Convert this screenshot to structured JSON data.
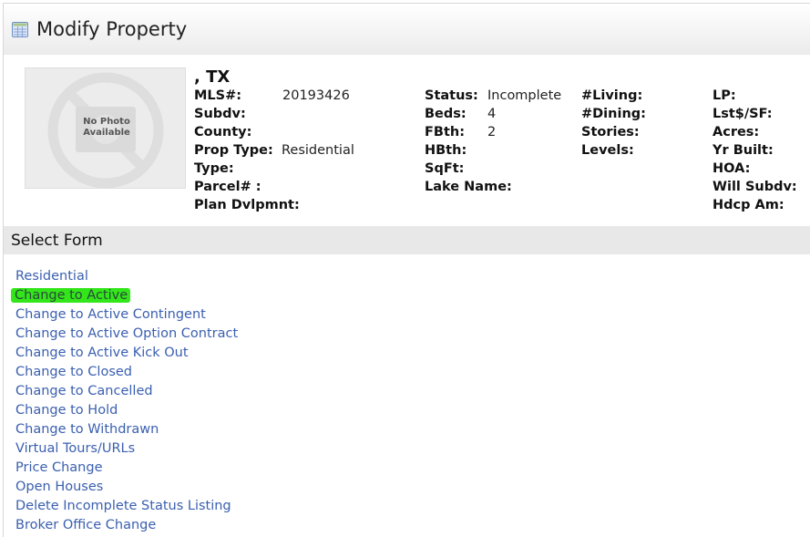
{
  "header": {
    "title": "Modify Property",
    "icon": "table-form-icon"
  },
  "listing": {
    "photo_placeholder": [
      "No Photo",
      "Available"
    ],
    "address": ", TX",
    "column1": [
      {
        "label": "MLS#:",
        "value": "20193426"
      },
      {
        "label": "Subdv:",
        "value": ""
      },
      {
        "label": "County:",
        "value": ""
      },
      {
        "label": "Prop Type:",
        "value": "Residential"
      },
      {
        "label": "Type:",
        "value": ""
      },
      {
        "label": "Parcel# :",
        "value": ""
      },
      {
        "label": "Plan Dvlpmnt:",
        "value": ""
      }
    ],
    "column2": [
      {
        "label": "Status:",
        "value": "Incomplete"
      },
      {
        "label": "Beds:",
        "value": "4"
      },
      {
        "label": "FBth:",
        "value": "2"
      },
      {
        "label": "HBth:",
        "value": ""
      },
      {
        "label": "SqFt:",
        "value": ""
      },
      {
        "label": "Lake Name:",
        "value": ""
      }
    ],
    "column3": [
      {
        "label": "#Living:",
        "value": ""
      },
      {
        "label": "#Dining:",
        "value": ""
      },
      {
        "label": "Stories:",
        "value": ""
      },
      {
        "label": "Levels:",
        "value": ""
      }
    ],
    "column4": [
      {
        "label": "LP:",
        "value": ""
      },
      {
        "label": "Lst$/SF:",
        "value": ""
      },
      {
        "label": "Acres:",
        "value": ""
      },
      {
        "label": "Yr Built:",
        "value": ""
      },
      {
        "label": "HOA:",
        "value": ""
      },
      {
        "label": "Will Subdv:",
        "value": ""
      },
      {
        "label": "Hdcp Am:",
        "value": ""
      }
    ]
  },
  "select_form": {
    "title": "Select Form",
    "highlight_color": "#33e61a",
    "link_color": "#3a5fb0",
    "forms": [
      {
        "label": "Residential",
        "highlighted": false
      },
      {
        "label": "Change to Active",
        "highlighted": true
      },
      {
        "label": "Change to Active Contingent",
        "highlighted": false
      },
      {
        "label": "Change to Active Option Contract",
        "highlighted": false
      },
      {
        "label": "Change to Active Kick Out",
        "highlighted": false
      },
      {
        "label": "Change to Closed",
        "highlighted": false
      },
      {
        "label": "Change to Cancelled",
        "highlighted": false
      },
      {
        "label": "Change to Hold",
        "highlighted": false
      },
      {
        "label": "Change to Withdrawn",
        "highlighted": false
      },
      {
        "label": "Virtual Tours/URLs",
        "highlighted": false
      },
      {
        "label": "Price Change",
        "highlighted": false
      },
      {
        "label": "Open Houses",
        "highlighted": false
      },
      {
        "label": "Delete Incomplete Status Listing",
        "highlighted": false
      },
      {
        "label": "Broker Office Change",
        "highlighted": false
      }
    ]
  }
}
